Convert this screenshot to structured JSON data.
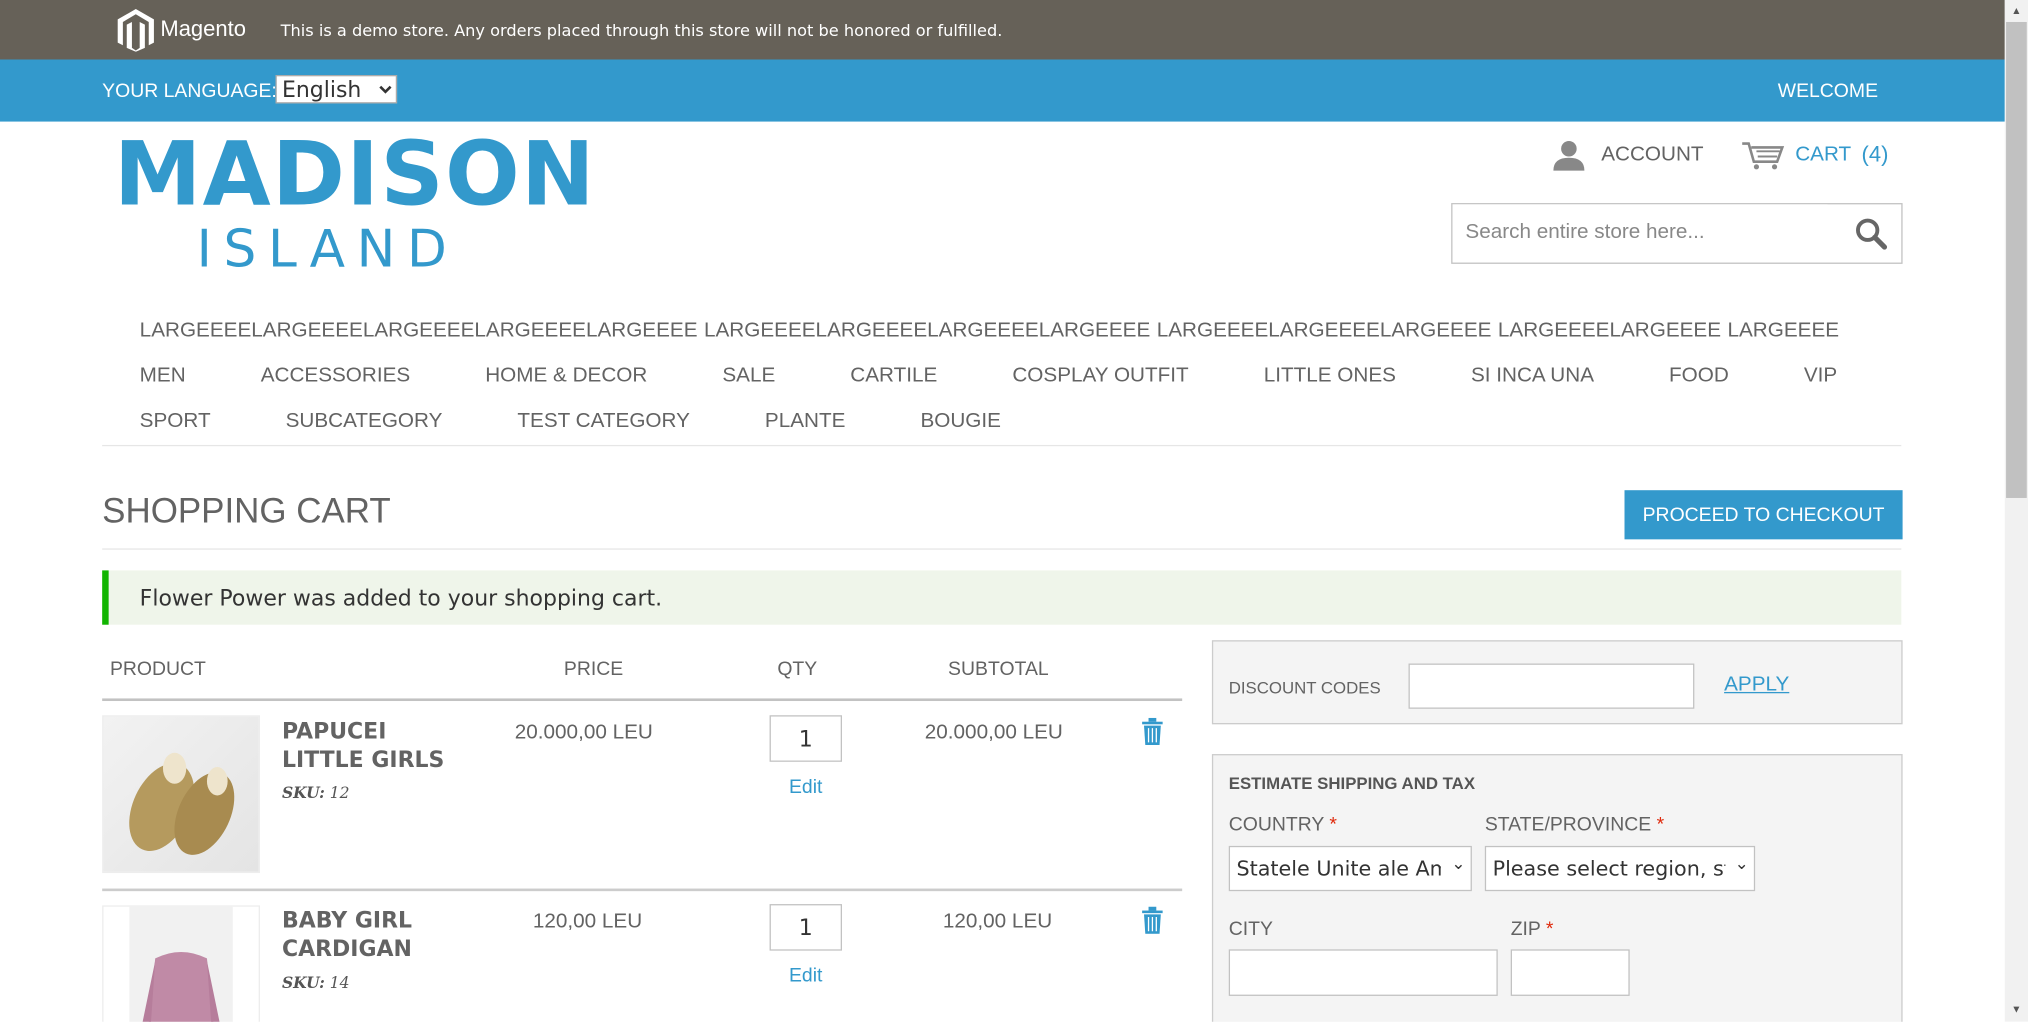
{
  "demo_notice": {
    "logo_text": "Magento",
    "message": "This is a demo store. Any orders placed through this store will not be honored or fulfilled."
  },
  "header_bar": {
    "language_label": "YOUR LANGUAGE:",
    "language_value": "English",
    "welcome": "WELCOME"
  },
  "brand": {
    "line1": "MADISON",
    "line2": "ISLAND",
    "color": "#3399cc"
  },
  "account": {
    "label": "ACCOUNT",
    "icon": "user-icon"
  },
  "cart": {
    "label": "CART",
    "count": "(4)",
    "icon": "cart-icon"
  },
  "search": {
    "placeholder": "Search entire store here...",
    "icon": "search-icon"
  },
  "nav": {
    "row1": [
      "LARGEEEELARGEEEELARGEEEELARGEEEELARGEEEE",
      "LARGEEEELARGEEEELARGEEEELARGEEEE",
      "LARGEEEELARGEEEELARGEEEE",
      "LARGEEEELARGEEEE",
      "LARGEEEE"
    ],
    "row2": [
      "MEN",
      "ACCESSORIES",
      "HOME & DECOR",
      "SALE",
      "CARTILE",
      "COSPLAY OUTFIT",
      "LITTLE ONES",
      "SI INCA UNA",
      "FOOD",
      "VIP"
    ],
    "row3": [
      "SPORT",
      "SUBCATEGORY",
      "TEST CATEGORY",
      "PLANTE",
      "BOUGIE"
    ]
  },
  "page": {
    "title": "SHOPPING CART",
    "checkout_label": "PROCEED TO CHECKOUT",
    "success_message": "Flower Power was added to your shopping cart."
  },
  "table": {
    "headers": [
      "PRODUCT",
      "PRICE",
      "QTY",
      "SUBTOTAL"
    ],
    "items": [
      {
        "name_line1": "PAPUCEI",
        "name_line2": "LITTLE GIRLS",
        "sku_label": "SKU:",
        "sku": "12",
        "price": "20.000,00 LEU",
        "qty": "1",
        "edit": "Edit",
        "subtotal": "20.000,00 LEU"
      },
      {
        "name_line1": "BABY GIRL",
        "name_line2": "CARDIGAN",
        "sku_label": "SKU:",
        "sku": "14",
        "price": "120,00 LEU",
        "qty": "1",
        "edit": "Edit",
        "subtotal": "120,00 LEU"
      }
    ]
  },
  "discount": {
    "label": "DISCOUNT CODES",
    "value": "",
    "apply": "APPLY"
  },
  "shipping": {
    "title": "ESTIMATE SHIPPING AND TAX",
    "country_label": "COUNTRY",
    "country_value": "Statele Unite ale Americii",
    "state_label": "STATE/PROVINCE",
    "state_value": "Please select region, state or province",
    "city_label": "CITY",
    "zip_label": "ZIP",
    "required_mark": "*"
  }
}
